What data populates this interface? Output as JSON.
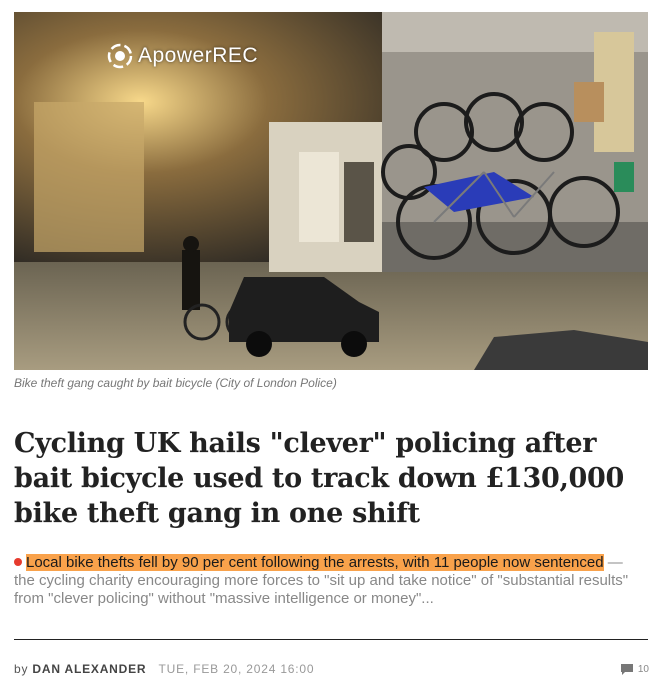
{
  "hero": {
    "watermark_text": "ApowerREC",
    "caption": "Bike theft gang caught by bait bicycle (City of London Police)"
  },
  "article": {
    "headline": "Cycling UK hails \"clever\" policing after bait bicycle used to track down £130,000 bike theft gang in one shift",
    "summary_highlight": "Local bike thefts fell by 90 per cent following the arrests, with 11 people now sentenced",
    "summary_rest": " — the cycling charity encouraging more forces to \"sit up and take notice\" of \"substantial results\" from \"clever policing\" without \"massive intelligence or money\"..."
  },
  "byline": {
    "prefix": "by",
    "author": "DAN ALEXANDER",
    "date": "TUE, FEB 20, 2024 16:00"
  },
  "comments": {
    "icon": "comment-icon",
    "count": "10"
  },
  "colors": {
    "highlight": "#f9a24b",
    "dot": "#e63b2e",
    "headline": "#222222"
  }
}
